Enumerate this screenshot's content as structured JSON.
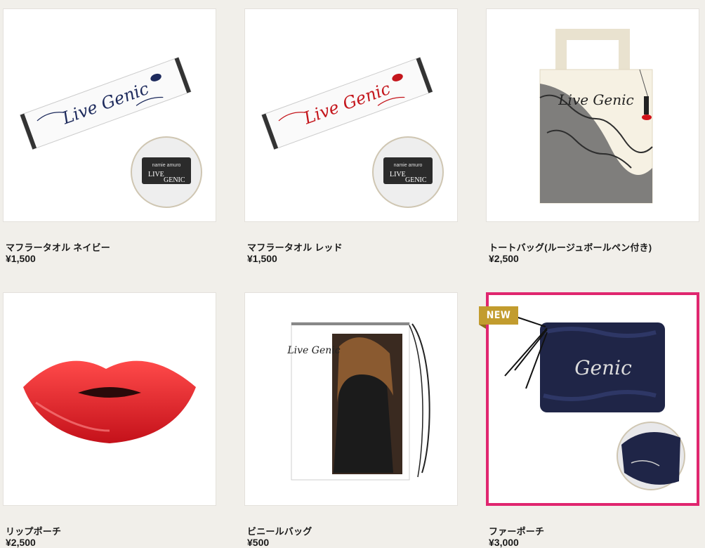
{
  "products": [
    {
      "name": "マフラータオル ネイビー",
      "price": "¥1,500",
      "logo_text": [
        "LIVE",
        "GENIC",
        "namie amuro"
      ],
      "script_text": "Live Genic"
    },
    {
      "name": "マフラータオル レッド",
      "price": "¥1,500",
      "logo_text": [
        "LIVE",
        "GENIC",
        "namie amuro"
      ],
      "script_text": "Live Genic"
    },
    {
      "name": "トートバッグ(ルージュボールペン付き)",
      "price": "¥2,500",
      "script_text": "Live Genic"
    },
    {
      "name": "リップポーチ",
      "price": "¥2,500"
    },
    {
      "name": "ビニールバッグ",
      "price": "¥500",
      "script_text": "Live Genic"
    },
    {
      "name": "ファーポーチ",
      "price": "¥3,000",
      "badge": "NEW",
      "script_text": "Genic"
    }
  ],
  "colors": {
    "background": "#f1efea",
    "highlight": "#e0266f",
    "badge": "#c29c2e"
  }
}
